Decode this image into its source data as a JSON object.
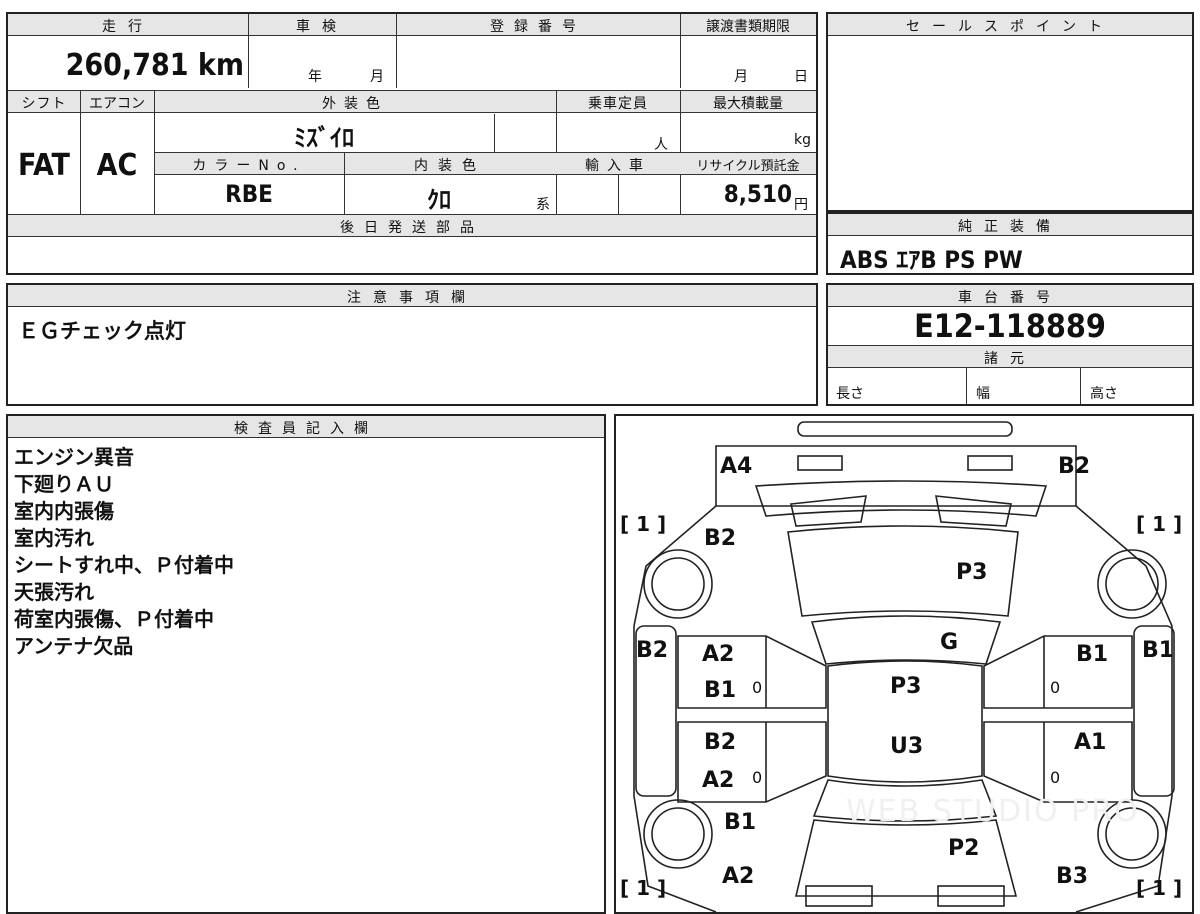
{
  "header": {
    "mileage_label": "走行",
    "inspection_label": "車検",
    "registration_label": "登録番号",
    "transfer_deadline_label": "譲渡書類期限",
    "sales_point_label": "セールスポイント",
    "mileage_value": "260,781 km",
    "year_label": "年",
    "month_label": "月",
    "transfer_month": "月",
    "transfer_day": "日"
  },
  "specs": {
    "shift_label": "シフト",
    "ac_label": "エアコン",
    "exterior_color_label": "外装色",
    "capacity_label": "乗車定員",
    "max_load_label": "最大積載量",
    "shift_value": "FAT",
    "ac_value": "AC",
    "exterior_color_value": "ﾐｽﾞｲﾛ",
    "capacity_unit": "人",
    "load_unit": "kg",
    "color_no_label": "カラーNo.",
    "interior_color_label": "内装色",
    "import_label": "輸入車",
    "recycle_label": "リサイクル預託金",
    "color_no_value": "RBE",
    "interior_color_value": "ｸﾛ",
    "interior_suffix": "系",
    "recycle_value": "8,510",
    "recycle_unit": "円",
    "later_parts_label": "後日発送部品"
  },
  "equipment": {
    "label": "純正装備",
    "value": "ABS ｴｱB PS PW"
  },
  "caution": {
    "label": "注意事項欄",
    "value": "ＥＧチェック点灯"
  },
  "chassis": {
    "label": "車台番号",
    "value": "E12-118889",
    "specs_label": "諸元",
    "length_label": "長さ",
    "width_label": "幅",
    "height_label": "高さ"
  },
  "inspector": {
    "label": "検査員記入欄",
    "notes": [
      "エンジン異音",
      "下廻りＡＵ",
      "室内内張傷",
      "室内汚れ",
      "シートすれ中、Ｐ付着中",
      "天張汚れ",
      "荷室内張傷、Ｐ付着中",
      "アンテナ欠品"
    ]
  },
  "diagram": {
    "front_left": "A4",
    "front_right": "B2",
    "tire_fl": "[ 1 ]",
    "tire_fr": "[ 1 ]",
    "tire_rl": "[ 1 ]",
    "tire_rr": "[ 1 ]",
    "fender_l": "B2",
    "hood": "P3",
    "windshield": "G",
    "left_side": "B2",
    "right_side": "B1",
    "front_door_l_top": "A2",
    "front_door_l_bottom": "B1",
    "front_door_r": "B1",
    "roof_front": "P3",
    "roof_rear": "U3",
    "rear_door_l_top": "B2",
    "rear_door_l_bottom": "A2",
    "rear_door_r": "A1",
    "rear_fender_l": "B1",
    "rear_hatch": "P2",
    "rear_l": "A2",
    "rear_r": "B3",
    "handle_mark": "0",
    "watermark": "WEB STUDIO PRO"
  }
}
